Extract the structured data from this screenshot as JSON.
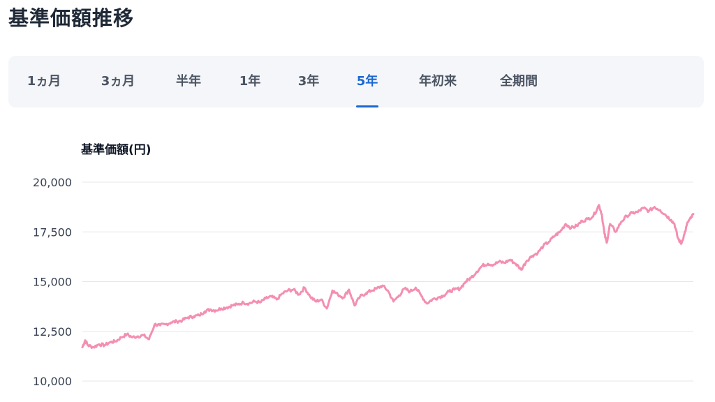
{
  "page": {
    "title": "基準価額推移"
  },
  "tabs": [
    {
      "label": "1ヵ月",
      "active": false
    },
    {
      "label": "3ヵ月",
      "active": false
    },
    {
      "label": "半年",
      "active": false
    },
    {
      "label": "1年",
      "active": false
    },
    {
      "label": "3年",
      "active": false
    },
    {
      "label": "5年",
      "active": true
    },
    {
      "label": "年初来",
      "active": false
    },
    {
      "label": "全期間",
      "active": false
    }
  ],
  "colors": {
    "line": "#f48fb1",
    "accent": "#1967d2",
    "grid": "#e5e7eb"
  },
  "chart_data": {
    "type": "line",
    "title": "",
    "ylabel": "基準価額(円)",
    "xlabel": "",
    "ylim": [
      10000,
      20000
    ],
    "yticks": [
      {
        "value": 20000,
        "label": "20,000"
      },
      {
        "value": 17500,
        "label": "17,500"
      },
      {
        "value": 15000,
        "label": "15,000"
      },
      {
        "value": 12500,
        "label": "12,500"
      },
      {
        "value": 10000,
        "label": "10,000"
      }
    ],
    "grid": true,
    "x_range": [
      0,
      100
    ],
    "series": [
      {
        "values": [
          [
            0,
            11700
          ],
          [
            0.5,
            12050
          ],
          [
            1,
            11800
          ],
          [
            2,
            11700
          ],
          [
            3,
            11850
          ],
          [
            4,
            11800
          ],
          [
            5,
            11950
          ],
          [
            6,
            12000
          ],
          [
            7,
            12200
          ],
          [
            8,
            12350
          ],
          [
            9,
            12200
          ],
          [
            10,
            12250
          ],
          [
            11,
            12300
          ],
          [
            12,
            12100
          ],
          [
            13,
            12850
          ],
          [
            14,
            12800
          ],
          [
            15,
            12850
          ],
          [
            16,
            12950
          ],
          [
            17,
            13000
          ],
          [
            18,
            13050
          ],
          [
            19,
            13200
          ],
          [
            20,
            13250
          ],
          [
            21,
            13300
          ],
          [
            22,
            13500
          ],
          [
            23,
            13600
          ],
          [
            24,
            13550
          ],
          [
            25,
            13650
          ],
          [
            26,
            13700
          ],
          [
            27,
            13800
          ],
          [
            28,
            13850
          ],
          [
            29,
            13950
          ],
          [
            30,
            13900
          ],
          [
            31,
            14000
          ],
          [
            32,
            13950
          ],
          [
            33,
            14150
          ],
          [
            34,
            14250
          ],
          [
            35,
            14100
          ],
          [
            36,
            14400
          ],
          [
            37,
            14550
          ],
          [
            38,
            14600
          ],
          [
            39,
            14350
          ],
          [
            40,
            14700
          ],
          [
            41,
            14250
          ],
          [
            42,
            14000
          ],
          [
            43,
            14100
          ],
          [
            44,
            13650
          ],
          [
            45,
            14550
          ],
          [
            46,
            14350
          ],
          [
            47,
            14200
          ],
          [
            48,
            14600
          ],
          [
            49,
            13800
          ],
          [
            50,
            14250
          ],
          [
            51,
            14400
          ],
          [
            52,
            14550
          ],
          [
            53,
            14650
          ],
          [
            54,
            14800
          ],
          [
            55,
            14550
          ],
          [
            56,
            14000
          ],
          [
            57,
            14300
          ],
          [
            58,
            14650
          ],
          [
            59,
            14500
          ],
          [
            60,
            14700
          ],
          [
            61,
            14300
          ],
          [
            62,
            13900
          ],
          [
            63,
            14100
          ],
          [
            64,
            14200
          ],
          [
            65,
            14300
          ],
          [
            66,
            14500
          ],
          [
            67,
            14600
          ],
          [
            68,
            14650
          ],
          [
            69,
            15000
          ],
          [
            70,
            15200
          ],
          [
            71,
            15500
          ],
          [
            72,
            15800
          ],
          [
            73,
            15900
          ],
          [
            74,
            15850
          ],
          [
            75,
            16000
          ],
          [
            76,
            15950
          ],
          [
            77,
            16100
          ],
          [
            78,
            15900
          ],
          [
            79,
            15600
          ],
          [
            80,
            16050
          ],
          [
            81,
            16300
          ],
          [
            82,
            16450
          ],
          [
            83,
            16800
          ],
          [
            84,
            17000
          ],
          [
            85,
            17300
          ],
          [
            86,
            17500
          ],
          [
            87,
            17900
          ],
          [
            88,
            17700
          ],
          [
            89,
            17800
          ],
          [
            90,
            18050
          ],
          [
            91,
            18150
          ],
          [
            92,
            18300
          ],
          [
            93,
            18850
          ],
          [
            93.5,
            18400
          ],
          [
            94,
            17400
          ],
          [
            94.4,
            16950
          ],
          [
            95,
            17900
          ],
          [
            96,
            17500
          ],
          [
            97,
            18000
          ],
          [
            98,
            18300
          ],
          [
            99,
            18450
          ],
          [
            100,
            18500
          ],
          [
            101,
            18700
          ],
          [
            102,
            18550
          ],
          [
            103,
            18750
          ],
          [
            104,
            18600
          ],
          [
            105,
            18350
          ],
          [
            106,
            18100
          ],
          [
            106.6,
            17900
          ],
          [
            107.2,
            17200
          ],
          [
            107.8,
            16900
          ],
          [
            108.4,
            17400
          ],
          [
            109,
            18000
          ],
          [
            109.6,
            18200
          ],
          [
            110,
            18400
          ]
        ]
      }
    ]
  }
}
